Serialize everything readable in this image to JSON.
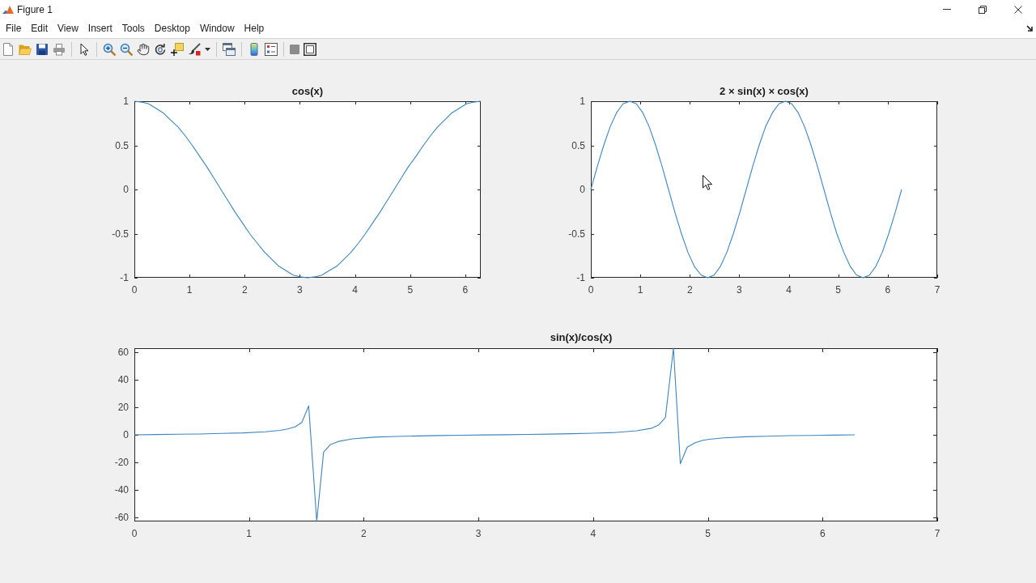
{
  "window": {
    "title": "Figure 1"
  },
  "menu_bar": [
    "File",
    "Edit",
    "View",
    "Insert",
    "Tools",
    "Desktop",
    "Window",
    "Help"
  ],
  "plots": [
    {
      "chart_data": {
        "type": "line",
        "title": "cos(x)",
        "x": [
          0,
          0.13,
          0.26,
          0.39,
          0.52,
          0.65,
          0.79,
          0.92,
          1.05,
          1.18,
          1.31,
          1.44,
          1.57,
          1.7,
          1.83,
          1.96,
          2.09,
          2.23,
          2.36,
          2.49,
          2.62,
          2.75,
          2.88,
          3.01,
          3.14,
          3.27,
          3.4,
          3.53,
          3.67,
          3.8,
          3.93,
          4.06,
          4.19,
          4.32,
          4.45,
          4.58,
          4.71,
          4.84,
          4.97,
          5.11,
          5.24,
          5.37,
          5.5,
          5.63,
          5.76,
          5.89,
          6.02,
          6.15,
          6.28
        ],
        "series": [
          {
            "color": "#3d85c0",
            "values": [
              1,
              0.99,
              0.97,
              0.92,
              0.87,
              0.79,
              0.71,
              0.61,
              0.5,
              0.38,
              0.26,
              0.13,
              0,
              -0.13,
              -0.26,
              -0.38,
              -0.5,
              -0.61,
              -0.71,
              -0.79,
              -0.87,
              -0.92,
              -0.97,
              -0.99,
              -1,
              -0.99,
              -0.97,
              -0.92,
              -0.87,
              -0.79,
              -0.71,
              -0.61,
              -0.5,
              -0.38,
              -0.26,
              -0.13,
              0,
              0.13,
              0.26,
              0.38,
              0.5,
              0.61,
              0.71,
              0.79,
              0.87,
              0.92,
              0.97,
              0.99,
              1
            ]
          }
        ],
        "xlim": [
          0,
          6.28
        ],
        "ylim": [
          -1,
          1
        ],
        "xticks": [
          0,
          1,
          2,
          3,
          4,
          5,
          6
        ],
        "yticks": [
          -1,
          -0.5,
          0,
          0.5,
          1
        ]
      }
    },
    {
      "chart_data": {
        "type": "line",
        "title": "2 × sin(x) × cos(x)",
        "x": [
          0,
          0.13,
          0.26,
          0.39,
          0.52,
          0.65,
          0.79,
          0.92,
          1.05,
          1.18,
          1.31,
          1.44,
          1.57,
          1.7,
          1.83,
          1.96,
          2.09,
          2.23,
          2.36,
          2.49,
          2.62,
          2.75,
          2.88,
          3.01,
          3.14,
          3.27,
          3.4,
          3.53,
          3.67,
          3.8,
          3.93,
          4.06,
          4.19,
          4.32,
          4.45,
          4.58,
          4.71,
          4.84,
          4.97,
          5.11,
          5.24,
          5.37,
          5.5,
          5.63,
          5.76,
          5.89,
          6.02,
          6.15,
          6.28
        ],
        "series": [
          {
            "color": "#3d85c0",
            "values": [
              0,
              0.26,
              0.5,
              0.71,
              0.87,
              0.97,
              1,
              0.97,
              0.87,
              0.71,
              0.5,
              0.26,
              0,
              -0.26,
              -0.5,
              -0.71,
              -0.87,
              -0.97,
              -1,
              -0.97,
              -0.87,
              -0.71,
              -0.5,
              -0.26,
              0,
              0.26,
              0.5,
              0.71,
              0.87,
              0.97,
              1,
              0.97,
              0.87,
              0.71,
              0.5,
              0.26,
              0,
              -0.26,
              -0.5,
              -0.71,
              -0.87,
              -0.97,
              -1,
              -0.97,
              -0.87,
              -0.71,
              -0.5,
              -0.26,
              0
            ]
          }
        ],
        "xlim": [
          0,
          7
        ],
        "ylim": [
          -1,
          1
        ],
        "xticks": [
          0,
          1,
          2,
          3,
          4,
          5,
          6,
          7
        ],
        "yticks": [
          -1,
          -0.5,
          0,
          0.5,
          1
        ]
      }
    },
    {
      "chart_data": {
        "type": "line",
        "title": "sin(x)/cos(x)",
        "x": [
          0,
          0.19,
          0.38,
          0.57,
          0.76,
          0.95,
          1.14,
          1.27,
          1.33,
          1.4,
          1.46,
          1.52,
          1.59,
          1.65,
          1.71,
          1.78,
          1.9,
          2.09,
          2.28,
          2.48,
          2.67,
          2.86,
          3.05,
          3.24,
          3.43,
          3.62,
          3.81,
          4,
          4.19,
          4.38,
          4.51,
          4.57,
          4.63,
          4.7,
          4.76,
          4.82,
          4.89,
          4.95,
          5.01,
          5.14,
          5.33,
          5.52,
          5.71,
          5.9,
          6.09,
          6.28
        ],
        "series": [
          {
            "color": "#3d85c0",
            "values": [
              0,
              0.2,
              0.4,
              0.6,
              1,
              1.4,
              2.2,
              3.2,
              4.1,
              5.7,
              9,
              21,
              -63,
              -12.6,
              -7,
              -4.8,
              -2.9,
              -1.7,
              -1.2,
              -0.8,
              -0.5,
              -0.3,
              -0.1,
              0.1,
              0.3,
              0.5,
              0.8,
              1.2,
              1.7,
              2.9,
              4.8,
              7,
              12.6,
              63,
              -21,
              -9,
              -5.7,
              -4.1,
              -3.2,
              -2.2,
              -1.4,
              -1,
              -0.6,
              -0.4,
              -0.2,
              0
            ]
          }
        ],
        "xlim": [
          0,
          7
        ],
        "ylim": [
          -63,
          63
        ],
        "xticks": [
          0,
          1,
          2,
          3,
          4,
          5,
          6,
          7
        ],
        "yticks": [
          -60,
          -40,
          -20,
          0,
          20,
          40,
          60
        ]
      }
    }
  ]
}
